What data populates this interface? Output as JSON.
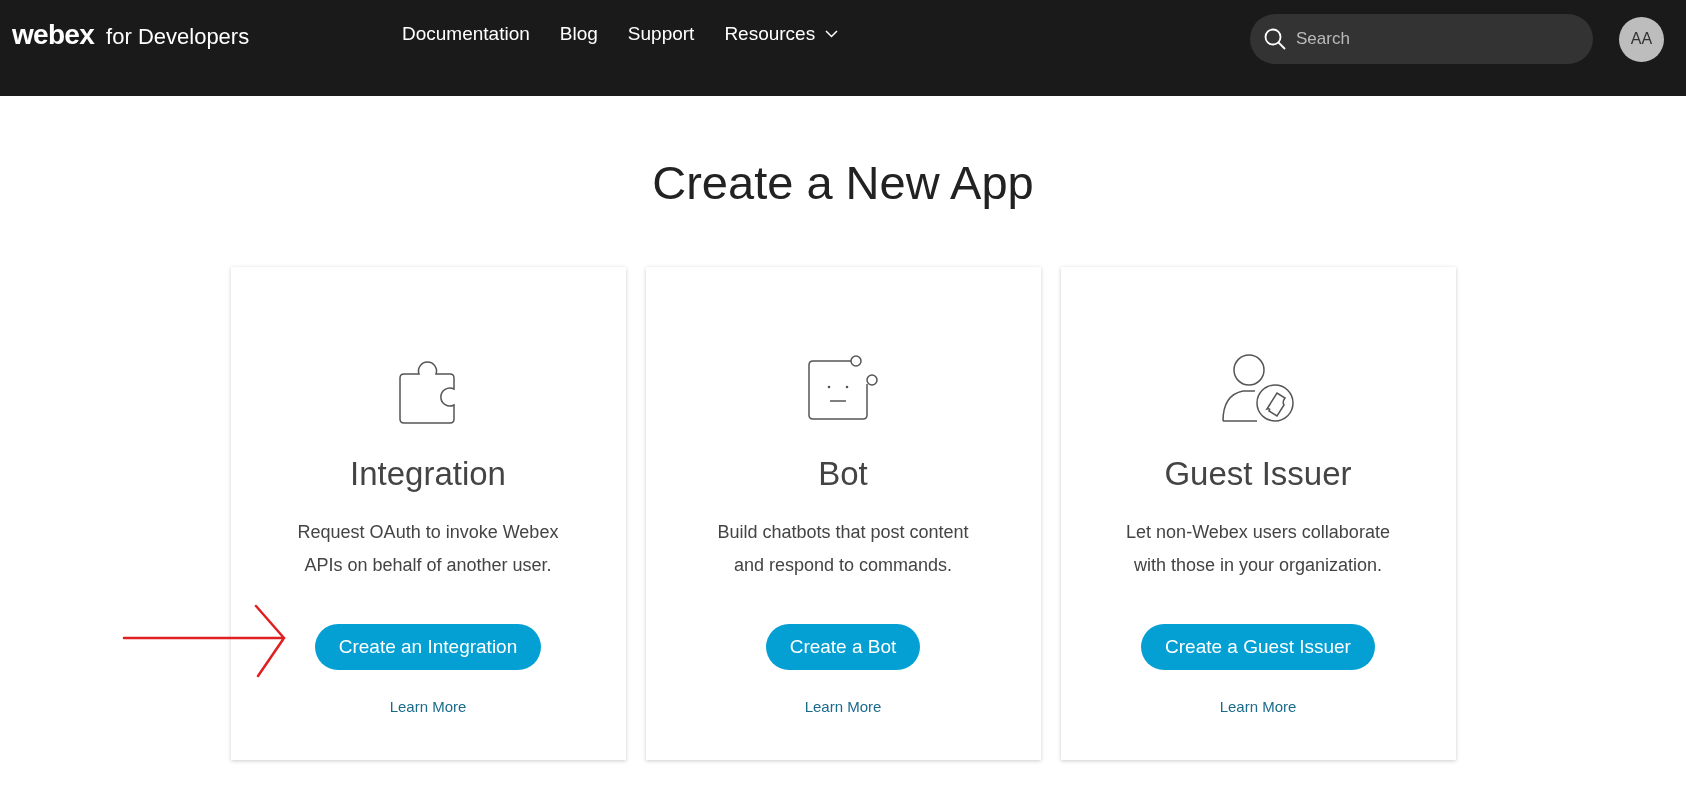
{
  "header": {
    "logo": "webex",
    "logo_suffix": "for Developers",
    "nav": [
      {
        "label": "Documentation",
        "kind": "link"
      },
      {
        "label": "Blog",
        "kind": "link"
      },
      {
        "label": "Support",
        "kind": "link"
      },
      {
        "label": "Resources",
        "kind": "dropdown"
      }
    ],
    "search": {
      "placeholder": "Search"
    },
    "avatar": "AA"
  },
  "title": "Create a New App",
  "cards": [
    {
      "kind": "integration",
      "title": "Integration",
      "description": "Request OAuth to invoke Webex APIs on behalf of another user.",
      "button": "Create an Integration",
      "link": "Learn More"
    },
    {
      "kind": "bot",
      "title": "Bot",
      "description": "Build chatbots that post content and respond to commands.",
      "button": "Create a Bot",
      "link": "Learn More"
    },
    {
      "kind": "guest",
      "title": "Guest Issuer",
      "description": "Let non-Webex users collaborate with those in your organization.",
      "button": "Create a Guest Issuer",
      "link": "Learn More"
    }
  ]
}
